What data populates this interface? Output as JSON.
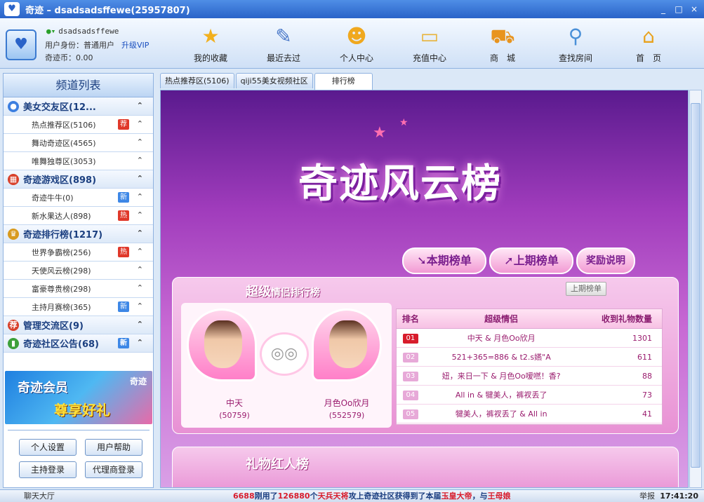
{
  "window": {
    "title": "奇迹 – dsadsadsffewe(25957807)",
    "min": "_",
    "max": "□",
    "close": "×"
  },
  "user": {
    "name": "dsadsadsffewe",
    "identity": "用户身份：普通用户",
    "upgrade": "升级VIP",
    "coins": "奇迹币：0.00"
  },
  "toolbar": [
    {
      "label": "我的收藏",
      "icon": "star-icon",
      "glyph": "★",
      "color": "#f2b01e"
    },
    {
      "label": "最近去过",
      "icon": "notepad-icon",
      "glyph": "✎",
      "color": "#4a78c8"
    },
    {
      "label": "个人中心",
      "icon": "person-icon",
      "glyph": "☻",
      "color": "#f0a81e"
    },
    {
      "label": "充值中心",
      "icon": "card-icon",
      "glyph": "▭",
      "color": "#e8b33a"
    },
    {
      "label": "商　城",
      "icon": "cart-icon",
      "glyph": "⛟",
      "color": "#e8941e"
    },
    {
      "label": "查找房间",
      "icon": "magnifier-icon",
      "glyph": "⚲",
      "color": "#4a90d8"
    },
    {
      "label": "首　页",
      "icon": "home-icon",
      "glyph": "⌂",
      "color": "#e8a21e"
    }
  ],
  "sidebar": {
    "title": "频道列表",
    "items": [
      {
        "type": "grp",
        "label": "美女交友区(12...",
        "icon": "globe-icon",
        "iconColor": "#3d7fe0"
      },
      {
        "type": "sub",
        "label": "热点推荐区(5106)",
        "tag": "荐",
        "tagType": "hot"
      },
      {
        "type": "sub",
        "label": "舞动奇迹区(4565)"
      },
      {
        "type": "sub",
        "label": "唯舞独尊区(3053)"
      },
      {
        "type": "grp",
        "label": "奇迹游戏区(898)",
        "icon": "store-icon",
        "iconColor": "#d8402a"
      },
      {
        "type": "sub",
        "label": "奇迹牛牛(0)",
        "tag": "新",
        "tagType": "new"
      },
      {
        "type": "sub",
        "label": "新水果达人(898)",
        "tag": "热",
        "tagType": "hot"
      },
      {
        "type": "grp",
        "label": "奇迹排行榜(1217)",
        "icon": "trophy-icon",
        "iconColor": "#d89a1e"
      },
      {
        "type": "sub",
        "label": "世界争霸榜(256)",
        "tag": "热",
        "tagType": "hot"
      },
      {
        "type": "sub",
        "label": "天使风云榜(298)"
      },
      {
        "type": "sub",
        "label": "富豪尊贵榜(298)"
      },
      {
        "type": "sub",
        "label": "主持月赛榜(365)",
        "tag": "新",
        "tagType": "new"
      },
      {
        "type": "grp",
        "label": "管理交流区(9)",
        "icon": "recommend-icon",
        "iconColor": "#d8402a"
      },
      {
        "type": "grp",
        "label": "奇迹社区公告(68)",
        "icon": "bar-chart-icon",
        "iconColor": "#3da03a",
        "tag": "新",
        "tagType": "new"
      }
    ],
    "banner": {
      "line1": "奇迹会员",
      "line2": "尊享好礼",
      "logo": "奇迹"
    },
    "buttons": [
      "个人设置",
      "用户帮助",
      "主持登录",
      "代理商登录"
    ]
  },
  "tabs": [
    "热点推荐区(5106)",
    "qiji55美女视频社区",
    "排行榜"
  ],
  "main": {
    "hero": "奇迹风云榜",
    "pills": [
      "本期榜单",
      "上期榜单",
      "奖励说明"
    ],
    "panel": {
      "title_big": "超级",
      "title_rest": "情侣排行榜",
      "prev": "上期榜单"
    },
    "couple": {
      "left_name": "中天",
      "left_num": "(50759)",
      "right_name": "月色Oo欣月",
      "right_num": "(552579)"
    },
    "table": {
      "headers": [
        "排名",
        "超级情侣",
        "收到礼物数量"
      ],
      "rows": [
        {
          "rank": "01",
          "names": "中天 & 月色Oo欣月",
          "gifts": "1301"
        },
        {
          "rank": "02",
          "names": "521+365=886 & t2.s嬿\"A",
          "gifts": "611"
        },
        {
          "rank": "03",
          "names": "妞，来日一下 & 月色Oo嗳嘫！香?",
          "gifts": "88"
        },
        {
          "rank": "04",
          "names": "All in & 犍美人，裤衩丢了",
          "gifts": "73"
        },
        {
          "rank": "05",
          "names": "犍美人，裤衩丢了 & All in",
          "gifts": "41"
        }
      ]
    },
    "panel2": {
      "title": "礼物红人榜"
    }
  },
  "status": {
    "left": "聊天大厅",
    "marquee_a": "6688",
    "marquee_b": "刚用了",
    "marquee_c": "126880",
    "marquee_d": "个",
    "marquee_e": "天兵天将",
    "marquee_f": "攻上奇迹社区获得到了本届",
    "marquee_g": "玉皇大帝",
    "marquee_h": "，与",
    "marquee_i": "王母娘",
    "keyboard": "举报",
    "clock": "17:41:20"
  }
}
